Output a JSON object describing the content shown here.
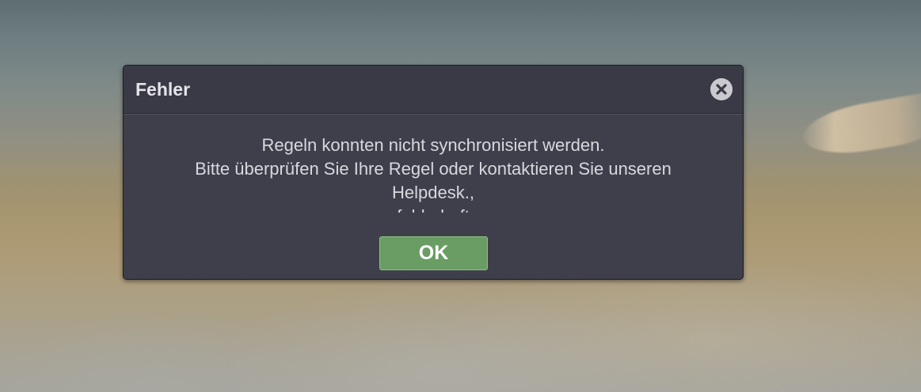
{
  "dialog": {
    "title": "Fehler",
    "close_icon": "close-circle-icon",
    "message_lines": [
      "Regeln konnten nicht synchronisiert werden.",
      "Bitte überprüfen Sie Ihre Regel oder kontaktieren Sie unseren",
      "Helpdesk.,",
      "fehlerhaft"
    ],
    "ok_label": "OK"
  },
  "colors": {
    "dialog_background": "#3f3f4b",
    "ok_button": "#6a9d64"
  }
}
